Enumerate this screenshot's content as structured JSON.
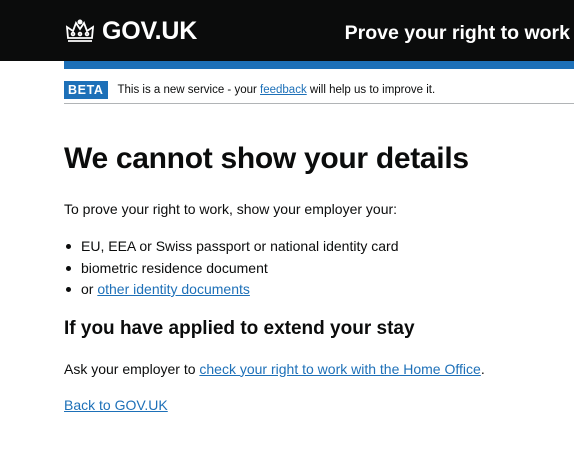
{
  "header": {
    "logo_text": "GOV.UK",
    "service_name": "Prove your right to work"
  },
  "phase_banner": {
    "tag": "BETA",
    "text_before": "This is a new service - your",
    "feedback_link": "feedback",
    "text_after": "will help us to improve it."
  },
  "main": {
    "heading": "We cannot show your details",
    "intro": "To prove your right to work, show your employer your:",
    "documents": [
      "EU, EEA or Swiss passport or national identity card",
      "biometric residence document"
    ],
    "other_docs_prefix": "or",
    "other_docs_link": "other identity documents",
    "subheading": "If you have applied to extend your stay",
    "ask_text": "Ask your employer to",
    "check_link": "check your right to work with the Home Office",
    "ask_suffix": ".",
    "back_link": "Back to GOV.UK"
  },
  "colors": {
    "header_bg": "#0b0c0c",
    "brand_blue": "#1d70b8",
    "text": "#0b0c0c",
    "link": "#1d70b8"
  },
  "icons": {
    "logo_icon": "crown-icon"
  }
}
